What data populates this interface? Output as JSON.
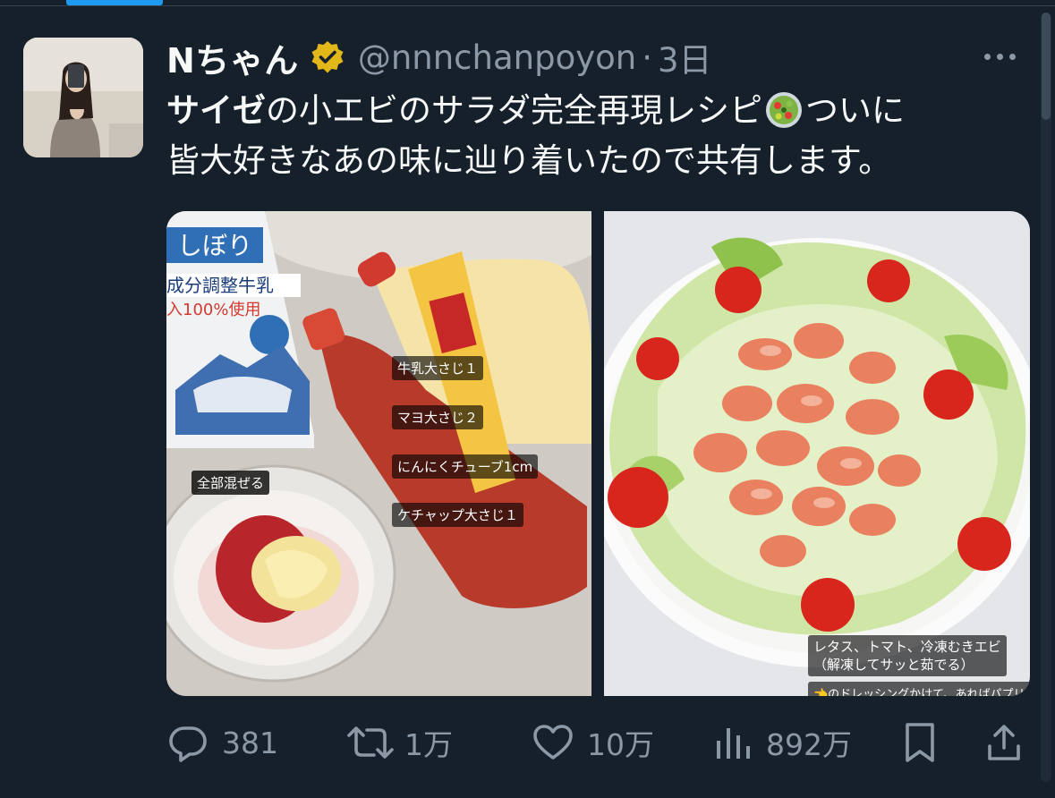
{
  "tweet": {
    "display_name": "Nちゃん",
    "handle": "@nnnchanpoyon",
    "separator": "·",
    "time": "3日",
    "text_bold": "サイゼ",
    "text_part1": "の小エビのサラダ完全再現レシピ",
    "text_part2": "ついに",
    "text_line2": "皆大好きなあの味に辿り着いたので共有します。"
  },
  "media": {
    "left_captions": {
      "mix_all": "全部混ぜる",
      "milk": "牛乳大さじ１",
      "mayo": "マヨ大さじ２",
      "garlic": "にんにくチューブ1cm",
      "ketchup": "ケチャップ大さじ１"
    },
    "right_captions": {
      "ingredients_line1": "レタス、トマト、冷凍むきエビ",
      "ingredients_line2": "（解凍してサッと茹でる）",
      "dressing": "👈のドレッシングかけて、あればパプリカ"
    }
  },
  "actions": {
    "replies": "381",
    "retweets": "1万",
    "likes": "10万",
    "views": "892万"
  },
  "colors": {
    "background": "#15202b",
    "text_primary": "#f7f9f9",
    "text_secondary": "#8b98a5",
    "accent": "#1d9bf0",
    "verified_gold": "#e2b719"
  }
}
